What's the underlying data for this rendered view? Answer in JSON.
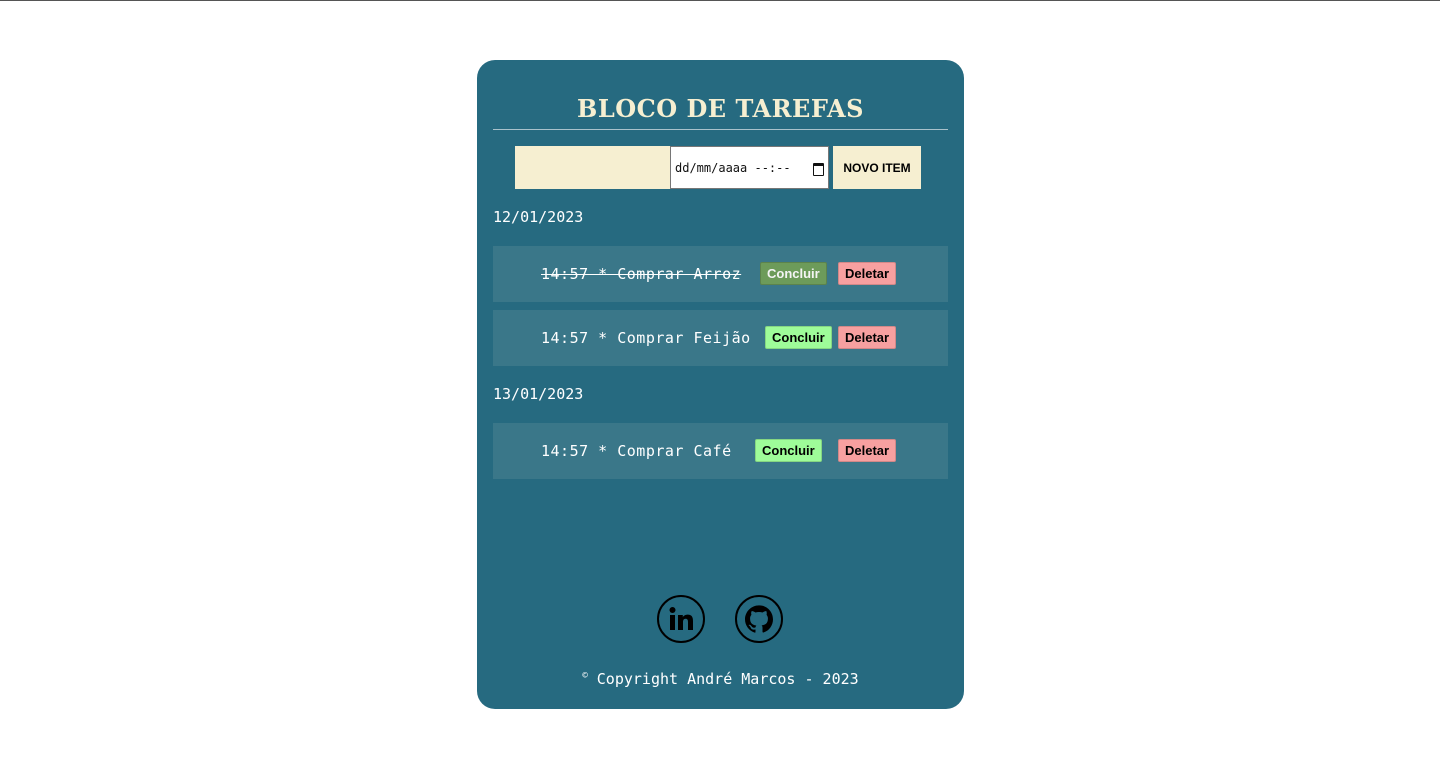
{
  "app": {
    "title": "BLOCO DE TAREFAS"
  },
  "form": {
    "task_value": "",
    "date_placeholder": "dd/mm/aaaa --:--",
    "new_button_label": "NOVO ITEM"
  },
  "groups": [
    {
      "date": "12/01/2023",
      "tasks": [
        {
          "text": "14:57 * Comprar Arroz",
          "done": true,
          "conclude_label": "Concluir",
          "delete_label": "Deletar"
        },
        {
          "text": "14:57 * Comprar Feijão",
          "done": false,
          "conclude_label": "Concluir",
          "delete_label": "Deletar"
        }
      ]
    },
    {
      "date": "13/01/2023",
      "tasks": [
        {
          "text": "14:57 * Comprar Café",
          "done": false,
          "conclude_label": "Concluir",
          "delete_label": "Deletar"
        }
      ]
    }
  ],
  "social": {
    "linkedin_icon": "linkedin-icon",
    "github_icon": "github-icon"
  },
  "footer": {
    "copyright_symbol": "©",
    "text": " Copyright André Marcos - 2023"
  },
  "colors": {
    "card": "#266a80",
    "row": "#3a7789",
    "cream": "#f6efd1",
    "conclude": "#9efc99",
    "conclude_done": "#6d9b5a",
    "delete": "#f7a0a0"
  }
}
